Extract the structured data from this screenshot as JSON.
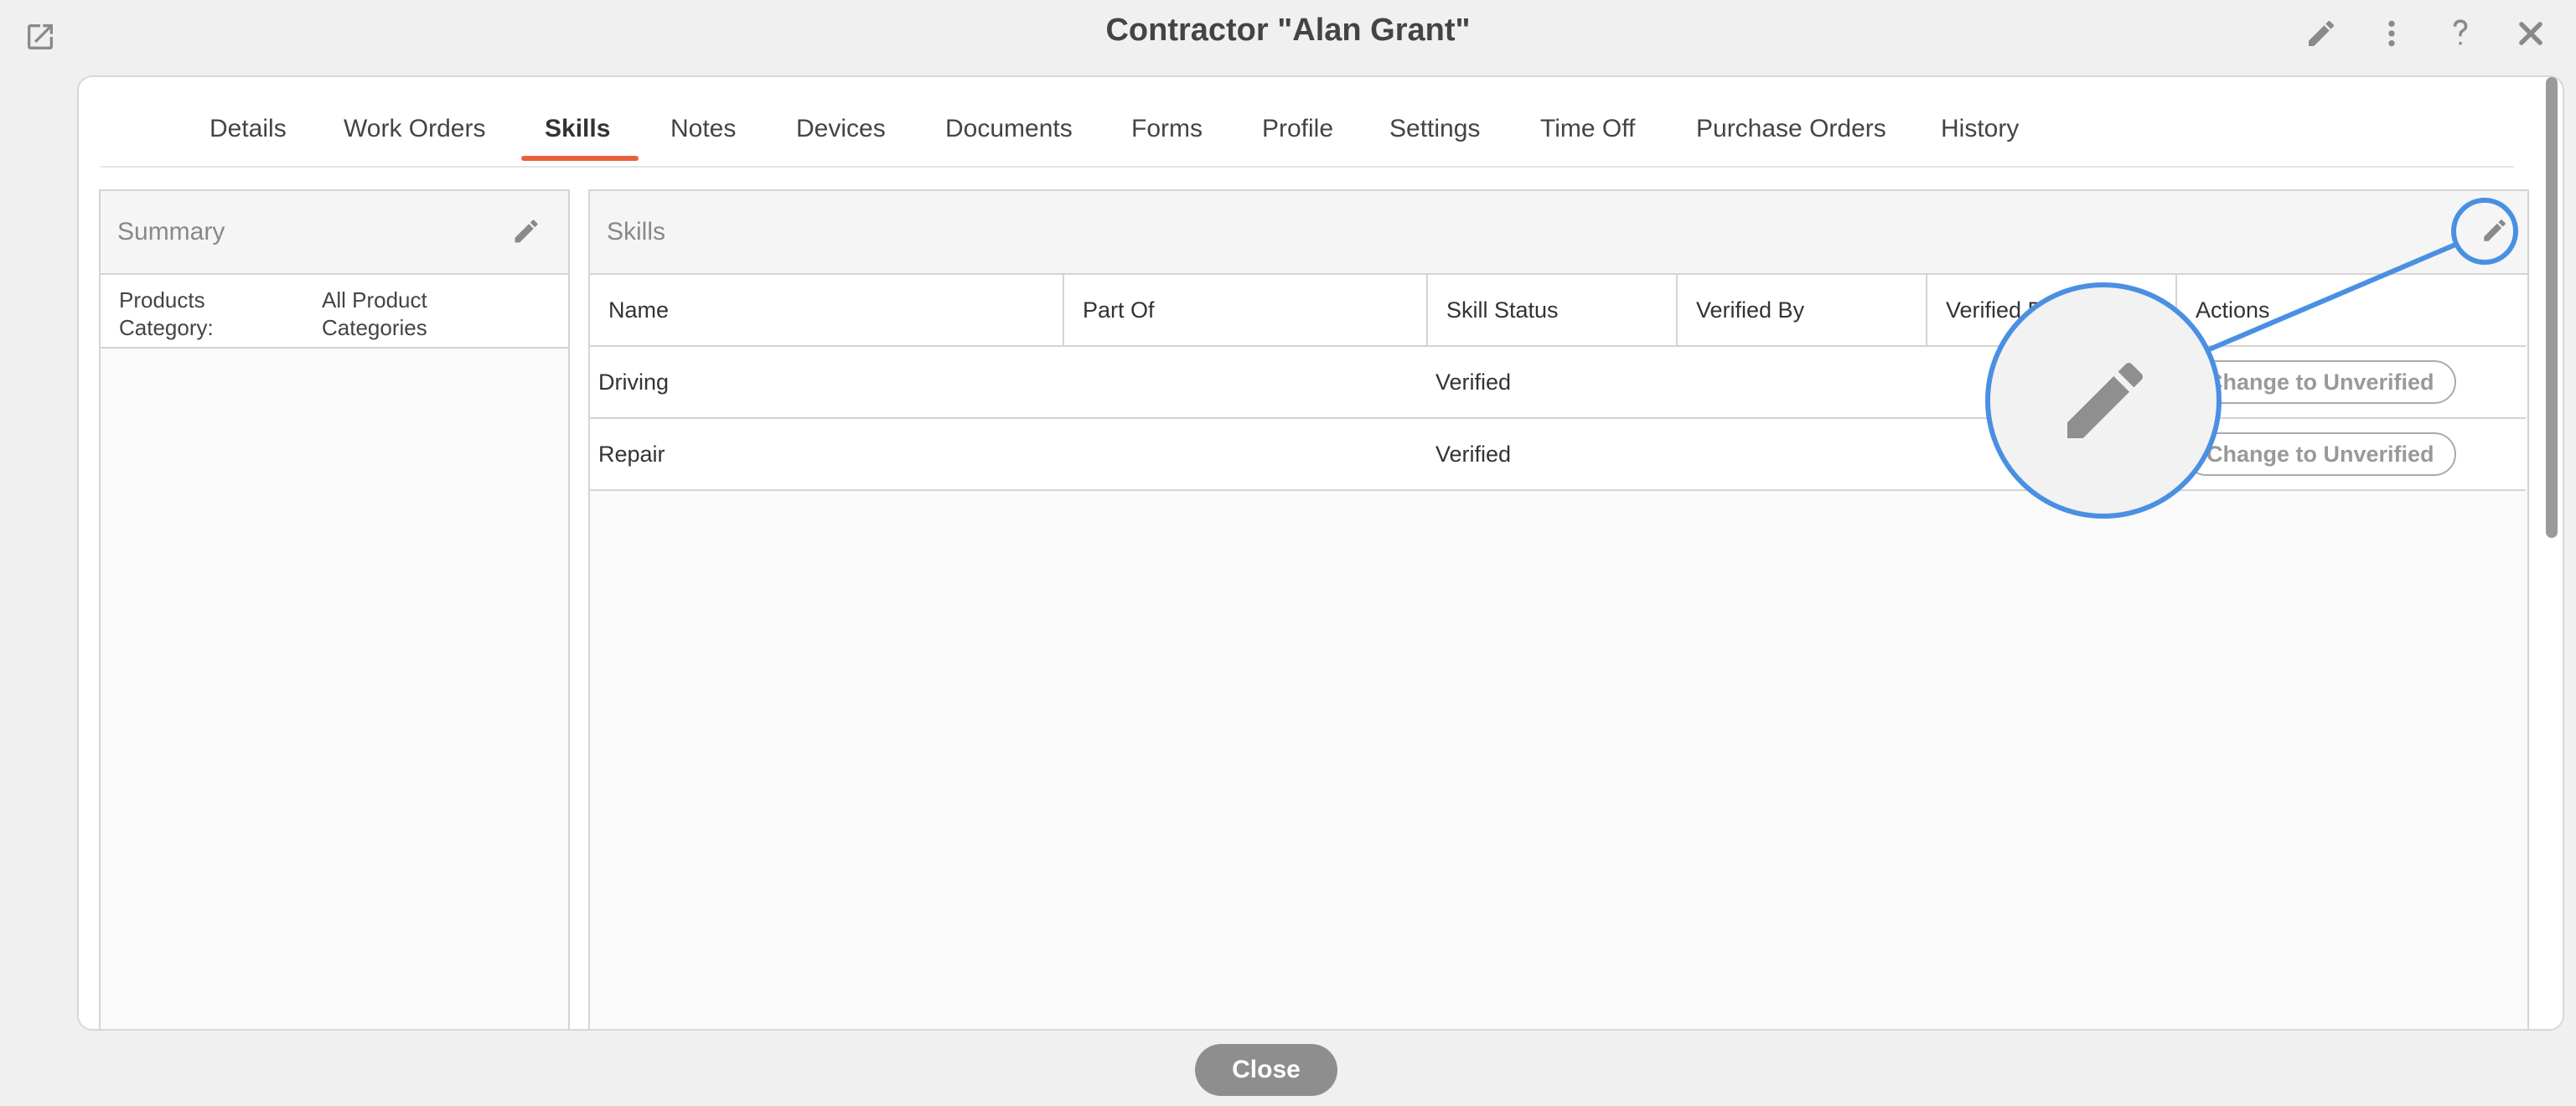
{
  "window": {
    "title": "Contractor \"Alan Grant\""
  },
  "top_icons": [
    "external-link-icon",
    "pencil-icon",
    "more-vertical-icon",
    "help-icon",
    "close-icon"
  ],
  "tabs": [
    {
      "label": "Details"
    },
    {
      "label": "Work Orders"
    },
    {
      "label": "Skills",
      "active": true
    },
    {
      "label": "Notes"
    },
    {
      "label": "Devices"
    },
    {
      "label": "Documents"
    },
    {
      "label": "Forms"
    },
    {
      "label": "Profile"
    },
    {
      "label": "Settings"
    },
    {
      "label": "Time Off"
    },
    {
      "label": "Purchase Orders"
    },
    {
      "label": "History"
    }
  ],
  "summary": {
    "title": "Summary",
    "rows": [
      {
        "label": "Products Category:",
        "value": "All Product Categories"
      }
    ]
  },
  "skills": {
    "title": "Skills",
    "columns": [
      "Name",
      "Part Of",
      "Skill Status",
      "Verified By",
      "Verified D",
      "Actions"
    ],
    "rows": [
      {
        "name": "Driving",
        "part_of": "",
        "status": "Verified",
        "verified_by": "",
        "verified_date": "",
        "action": "Change to Unverified"
      },
      {
        "name": "Repair",
        "part_of": "",
        "status": "Verified",
        "verified_by": "",
        "verified_date": "",
        "action": "Change to Unverified"
      }
    ]
  },
  "footer": {
    "close_label": "Close"
  },
  "colors": {
    "accent": "#e8603c",
    "highlight": "#4a90e2"
  }
}
